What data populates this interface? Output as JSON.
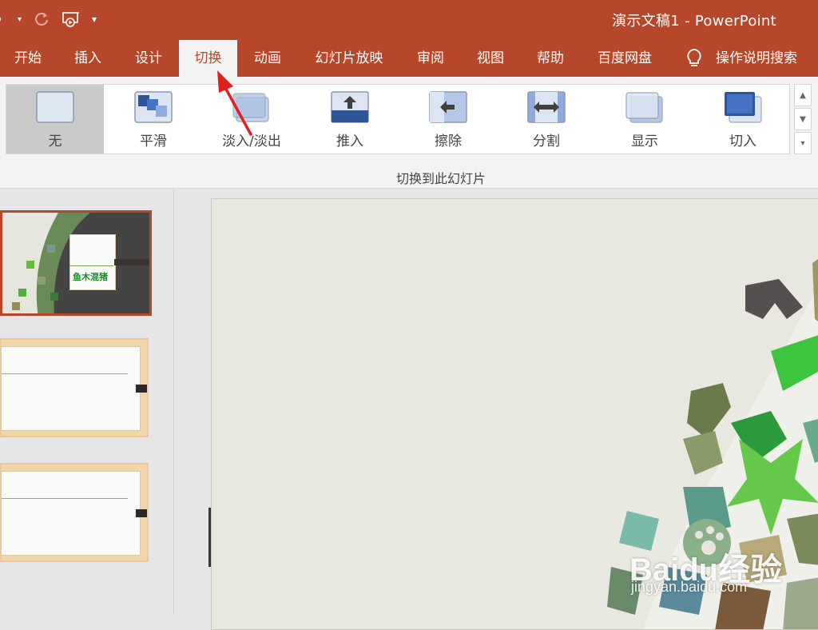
{
  "window": {
    "title": "演示文稿1  -  PowerPoint"
  },
  "qat": {
    "icons": [
      "save-icon",
      "undo-dropdown-icon",
      "redo-icon",
      "from-beginning-icon",
      "customize-qat-icon"
    ]
  },
  "tabs": [
    {
      "label": "开始"
    },
    {
      "label": "插入"
    },
    {
      "label": "设计"
    },
    {
      "label": "切换",
      "active": true
    },
    {
      "label": "动画"
    },
    {
      "label": "幻灯片放映"
    },
    {
      "label": "审阅"
    },
    {
      "label": "视图"
    },
    {
      "label": "帮助"
    },
    {
      "label": "百度网盘"
    }
  ],
  "tell_me": {
    "label": "操作说明搜索",
    "icon": "lightbulb-icon"
  },
  "gallery": {
    "items": [
      {
        "label": "无",
        "icon": "none-transition-icon",
        "selected": true
      },
      {
        "label": "平滑",
        "icon": "morph-transition-icon"
      },
      {
        "label": "淡入/淡出",
        "icon": "fade-transition-icon"
      },
      {
        "label": "推入",
        "icon": "push-transition-icon"
      },
      {
        "label": "擦除",
        "icon": "wipe-transition-icon"
      },
      {
        "label": "分割",
        "icon": "split-transition-icon"
      },
      {
        "label": "显示",
        "icon": "reveal-transition-icon"
      },
      {
        "label": "切入",
        "icon": "cut-transition-icon"
      }
    ],
    "group_label": "切换到此幻灯片"
  },
  "slides": {
    "thumb1_text": "鱼木混猪"
  },
  "colors": {
    "accent": "#b7472a",
    "ribbon_bg": "#f3f3f3",
    "selected_item": "#c9c9c9",
    "arrow": "#e02020"
  },
  "watermark": {
    "main": "Baidu经验",
    "sub": "jingyan.baidu.com"
  }
}
